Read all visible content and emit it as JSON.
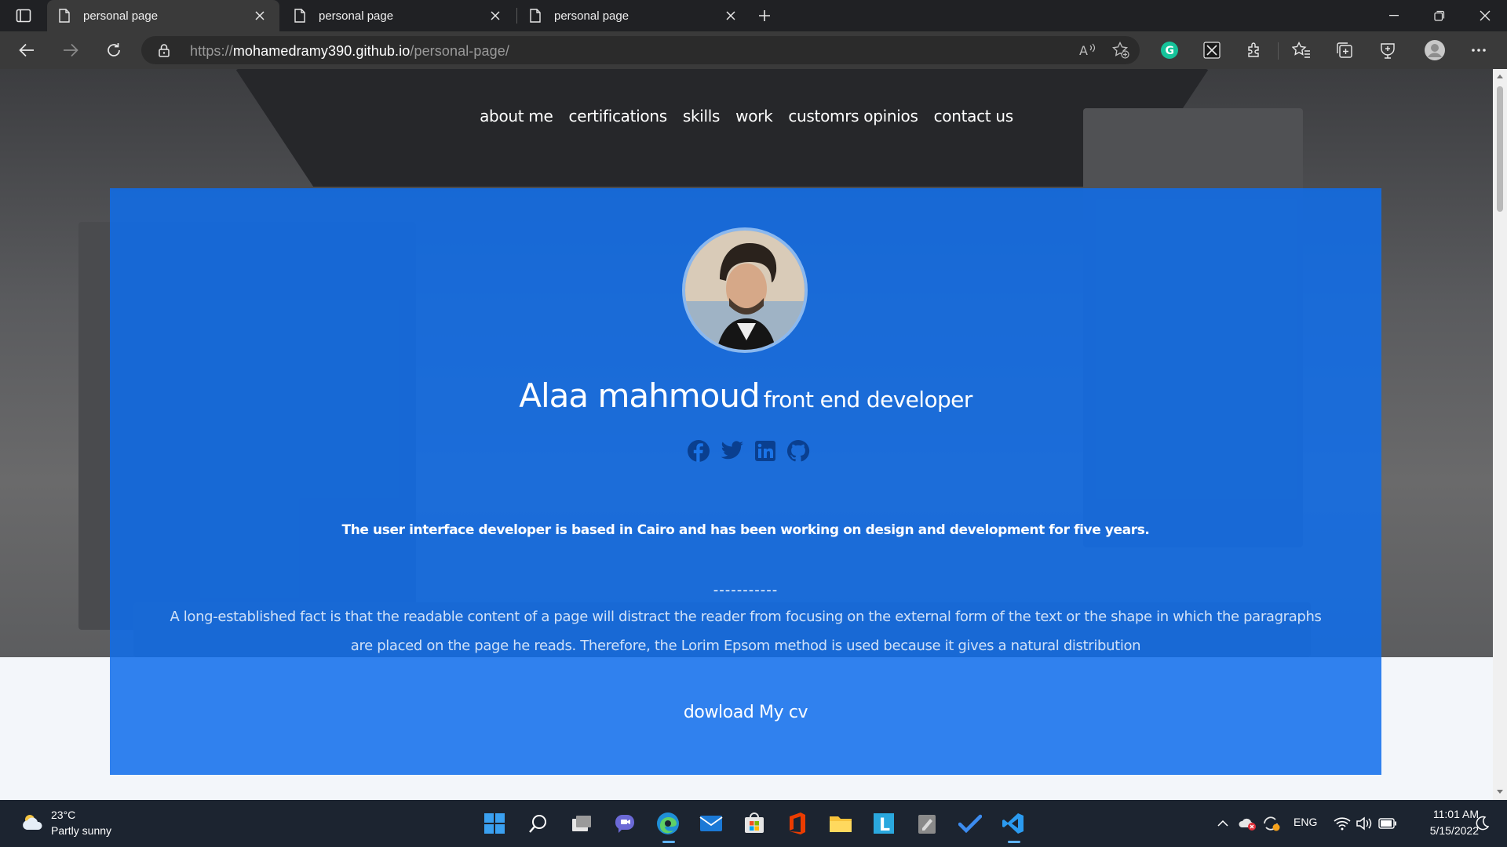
{
  "browser": {
    "tabs": [
      {
        "title": "personal page",
        "active": true
      },
      {
        "title": "personal page",
        "active": false
      },
      {
        "title": "personal page",
        "active": false
      }
    ],
    "url_scheme": "https://",
    "url_host": "mohamedramy390.github.io",
    "url_path": "/personal-page/",
    "toolbar_icons": [
      "back-icon",
      "forward-icon",
      "refresh-icon",
      "lock-icon",
      "read-aloud-icon",
      "add-favorite-icon",
      "grammarly-icon",
      "extension-icon",
      "extensions-icon",
      "favorites-icon",
      "collections-icon",
      "browser-essentials-icon",
      "profile-icon",
      "more-icon"
    ]
  },
  "page": {
    "nav": [
      "about me",
      "certifications",
      "skills",
      "work",
      "customrs opinios",
      "contact us"
    ],
    "name": "Alaa mahmoud",
    "role": "front end developer",
    "socials": [
      "facebook-icon",
      "twitter-icon",
      "linkedin-icon",
      "github-icon"
    ],
    "bio": "The user interface developer is based in Cairo and has been working on design and development for five years.",
    "divider": "-----------",
    "lorem": "A long-established fact is that the readable content of a page will distract the reader from focusing on the external form of the text or the shape in which the paragraphs are placed on the page he reads. Therefore, the Lorim Epsom method is used because it gives a natural distribution",
    "cv_link": "dowload My cv",
    "card_color": "#0f6eeb"
  },
  "taskbar": {
    "temp": "23°C",
    "weather": "Partly sunny",
    "lang": "ENG",
    "time": "11:01 AM",
    "date": "5/15/2022",
    "apps": [
      "start-icon",
      "search-icon",
      "task-view-icon",
      "chat-icon",
      "edge-icon",
      "mail-icon",
      "store-icon",
      "office-icon",
      "file-explorer-icon",
      "lingoes-icon",
      "notepad-icon",
      "todo-icon",
      "vscode-icon"
    ]
  }
}
